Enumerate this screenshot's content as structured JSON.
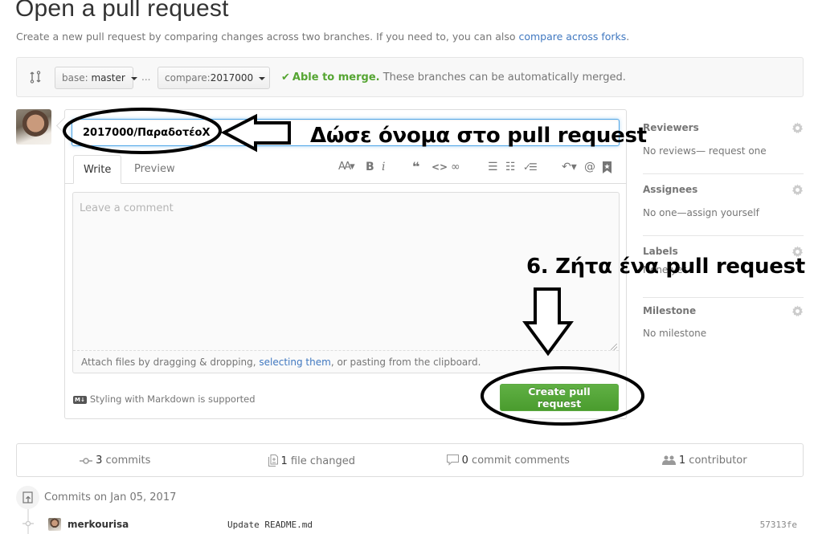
{
  "header": {
    "title": "Open a pull request",
    "subtitle": "Create a new pull request by comparing changes across two branches. If you need to, you can also ",
    "subtitle_link": "compare across forks",
    "subtitle_end": "."
  },
  "range": {
    "base_label": "base:",
    "base_value": "master",
    "separator": "...",
    "compare_label": "compare:",
    "compare_value": "2017000",
    "merge_check": "✔",
    "merge_ok": "Able to merge.",
    "merge_text": " These branches can be automatically merged."
  },
  "compose": {
    "title_value": "2017000/ΠαραδοτέοΧ",
    "tabs": [
      {
        "label": "Write",
        "active": true
      },
      {
        "label": "Preview",
        "active": false
      }
    ],
    "toolbar": {
      "header": "AA▾",
      "bold": "B",
      "italic": "i",
      "quote": "❝",
      "code": "<>",
      "link": "∞",
      "bullet_list": "☰",
      "numbered_list": "☷",
      "task_list": "✓☰",
      "reply": "↶▾",
      "mention": "@",
      "reference": "🔖"
    },
    "comment_placeholder": "Leave a comment",
    "attach_text_start": "Attach files by dragging & dropping, ",
    "attach_link": "selecting them",
    "attach_text_end": ", or pasting from the clipboard.",
    "markdown_badge": "M↓",
    "markdown_note": "Styling with Markdown is supported",
    "submit_label": "Create pull request"
  },
  "sidebar": {
    "sections": [
      {
        "heading": "Reviewers",
        "body": "No reviews— request one"
      },
      {
        "heading": "Assignees",
        "body": "No one—assign yourself"
      },
      {
        "heading": "Labels",
        "body": "None yet"
      },
      {
        "heading": "Milestone",
        "body": "No milestone"
      }
    ]
  },
  "stats": {
    "commits_count": "3",
    "commits_label": " commits",
    "files_count": "1",
    "files_label": " file changed",
    "comments_count": "0",
    "comments_label": " commit comments",
    "contributors_count": "1",
    "contributors_label": " contributor"
  },
  "commits": {
    "date_heading": "Commits on Jan 05, 2017",
    "items": [
      {
        "author": "merkourisa",
        "message": "Update README.md",
        "sha": "57313fe"
      }
    ]
  },
  "annotations": {
    "name_hint": "Δώσε όνομα στο pull request",
    "submit_hint": "6. Ζήτα ένα pull request"
  },
  "colors": {
    "accent_link": "#4078c0",
    "merge_ok": "#55a532",
    "primary_button": "#55a532",
    "focus_border": "#51a7e8"
  }
}
